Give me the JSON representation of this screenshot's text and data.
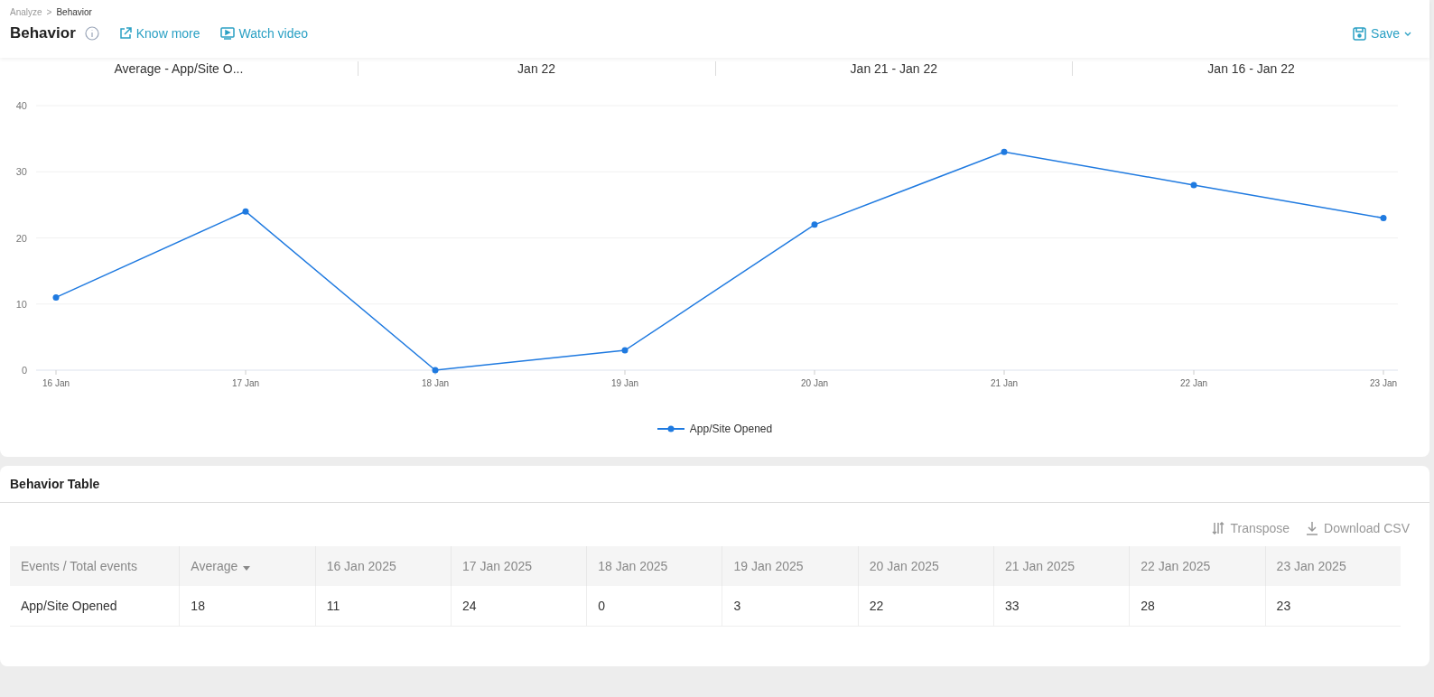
{
  "breadcrumb": [
    {
      "label": "Analyze",
      "selected": false
    },
    {
      "label": "Behavior",
      "selected": true
    }
  ],
  "breadcrumb_separator": ">",
  "page_title": "Behavior",
  "header_links": [
    {
      "label": "Know more",
      "kind": "external"
    },
    {
      "label": "Watch video",
      "kind": "video"
    }
  ],
  "save_button": {
    "label": "Save"
  },
  "summary": [
    "Average - App/Site O...",
    "Jan 22",
    "Jan 21 - Jan 22",
    "Jan 16 - Jan 22"
  ],
  "chart": {
    "chart_data": {
      "type": "line",
      "categories": [
        "16 Jan",
        "17 Jan",
        "18 Jan",
        "19 Jan",
        "20 Jan",
        "21 Jan",
        "22 Jan",
        "23 Jan"
      ],
      "ylim": [
        0,
        40
      ],
      "yticks": [
        {
          "value": 0,
          "label": "0"
        },
        {
          "value": 10,
          "label": "10"
        },
        {
          "value": 20,
          "label": "20"
        },
        {
          "value": 30,
          "label": "30"
        },
        {
          "value": 40,
          "label": "40"
        }
      ],
      "grid": true,
      "series": [
        {
          "name": "App/Site Opened",
          "color": "#1f7ae0",
          "values": [
            11,
            24,
            0,
            3,
            22,
            33,
            28,
            23
          ],
          "marker": "circle"
        }
      ]
    }
  },
  "table_section": {
    "title": "Behavior Table",
    "actions": [
      {
        "label": "Transpose",
        "kind": "transpose"
      },
      {
        "label": "Download CSV",
        "kind": "download"
      }
    ],
    "columns": [
      {
        "label": "Events / Total events",
        "sortable": false
      },
      {
        "label": "Average",
        "sortable": true
      },
      {
        "label": "16 Jan 2025",
        "sortable": false
      },
      {
        "label": "17 Jan 2025",
        "sortable": false
      },
      {
        "label": "18 Jan 2025",
        "sortable": false
      },
      {
        "label": "19 Jan 2025",
        "sortable": false
      },
      {
        "label": "20 Jan 2025",
        "sortable": false
      },
      {
        "label": "21 Jan 2025",
        "sortable": false
      },
      {
        "label": "22 Jan 2025",
        "sortable": false
      },
      {
        "label": "23 Jan 2025",
        "sortable": false
      }
    ],
    "rows": [
      [
        "App/Site Opened",
        "18",
        "11",
        "24",
        "0",
        "3",
        "22",
        "33",
        "28",
        "23"
      ]
    ]
  }
}
